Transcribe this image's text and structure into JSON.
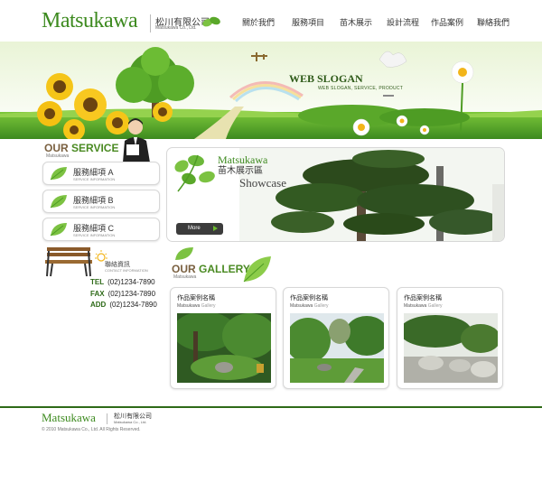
{
  "header": {
    "logo": "Matsukawa",
    "company_cn": "松川有限公司",
    "company_en": "Matsukawa Co., Ltd."
  },
  "nav": [
    "關於我們",
    "服務項目",
    "苗木展示",
    "設計流程",
    "作品案例",
    "聯絡我們"
  ],
  "banner": {
    "slogan": "WEB SLOGAN",
    "slogan_sub": "WEB SLOGAN, SERVICE, PRODUCT"
  },
  "service": {
    "title_prefix": "OUR",
    "title_rest": " SERVICE",
    "subtitle": "Matsukawa",
    "items": [
      {
        "label": "服務細項 A",
        "sub": "SERVICE INFORMATION"
      },
      {
        "label": "服務細項 B",
        "sub": "SERVICE INFORMATION"
      },
      {
        "label": "服務細項 C",
        "sub": "SERVICE INFORMATION"
      }
    ]
  },
  "contact": {
    "title": "聯絡資訊",
    "subtitle": "CONTACT INFORMATION",
    "rows": [
      {
        "k": "TEL",
        "v": "(02)1234-7890"
      },
      {
        "k": "FAX",
        "v": "(02)1234-7890"
      },
      {
        "k": "ADD",
        "v": "(02)1234-7890"
      }
    ]
  },
  "showcase": {
    "brand": "Matsukawa",
    "title_cn": "苗木展示區",
    "title_en": "Showcase",
    "more": "More"
  },
  "gallery": {
    "title_prefix": "OUR",
    "title_rest": " GALLERY",
    "subtitle": "Matsukawa",
    "cards": [
      {
        "title": "作品案例名稱",
        "brand": "Matsukawa",
        "category": "Gallery"
      },
      {
        "title": "作品案例名稱",
        "brand": "Matsukawa",
        "category": "Gallery"
      },
      {
        "title": "作品案例名稱",
        "brand": "Matsukawa",
        "category": "Gallery"
      }
    ]
  },
  "footer": {
    "logo": "Matsukawa",
    "company_cn": "松川有限公司",
    "company_en": "Matsukawa Co., Ltd.",
    "copyright": "© 2010 Matsukawa Co., Ltd. All Rights Reserved."
  },
  "colors": {
    "brand_green": "#3d8a1f",
    "footer_line": "#2e6a18"
  }
}
